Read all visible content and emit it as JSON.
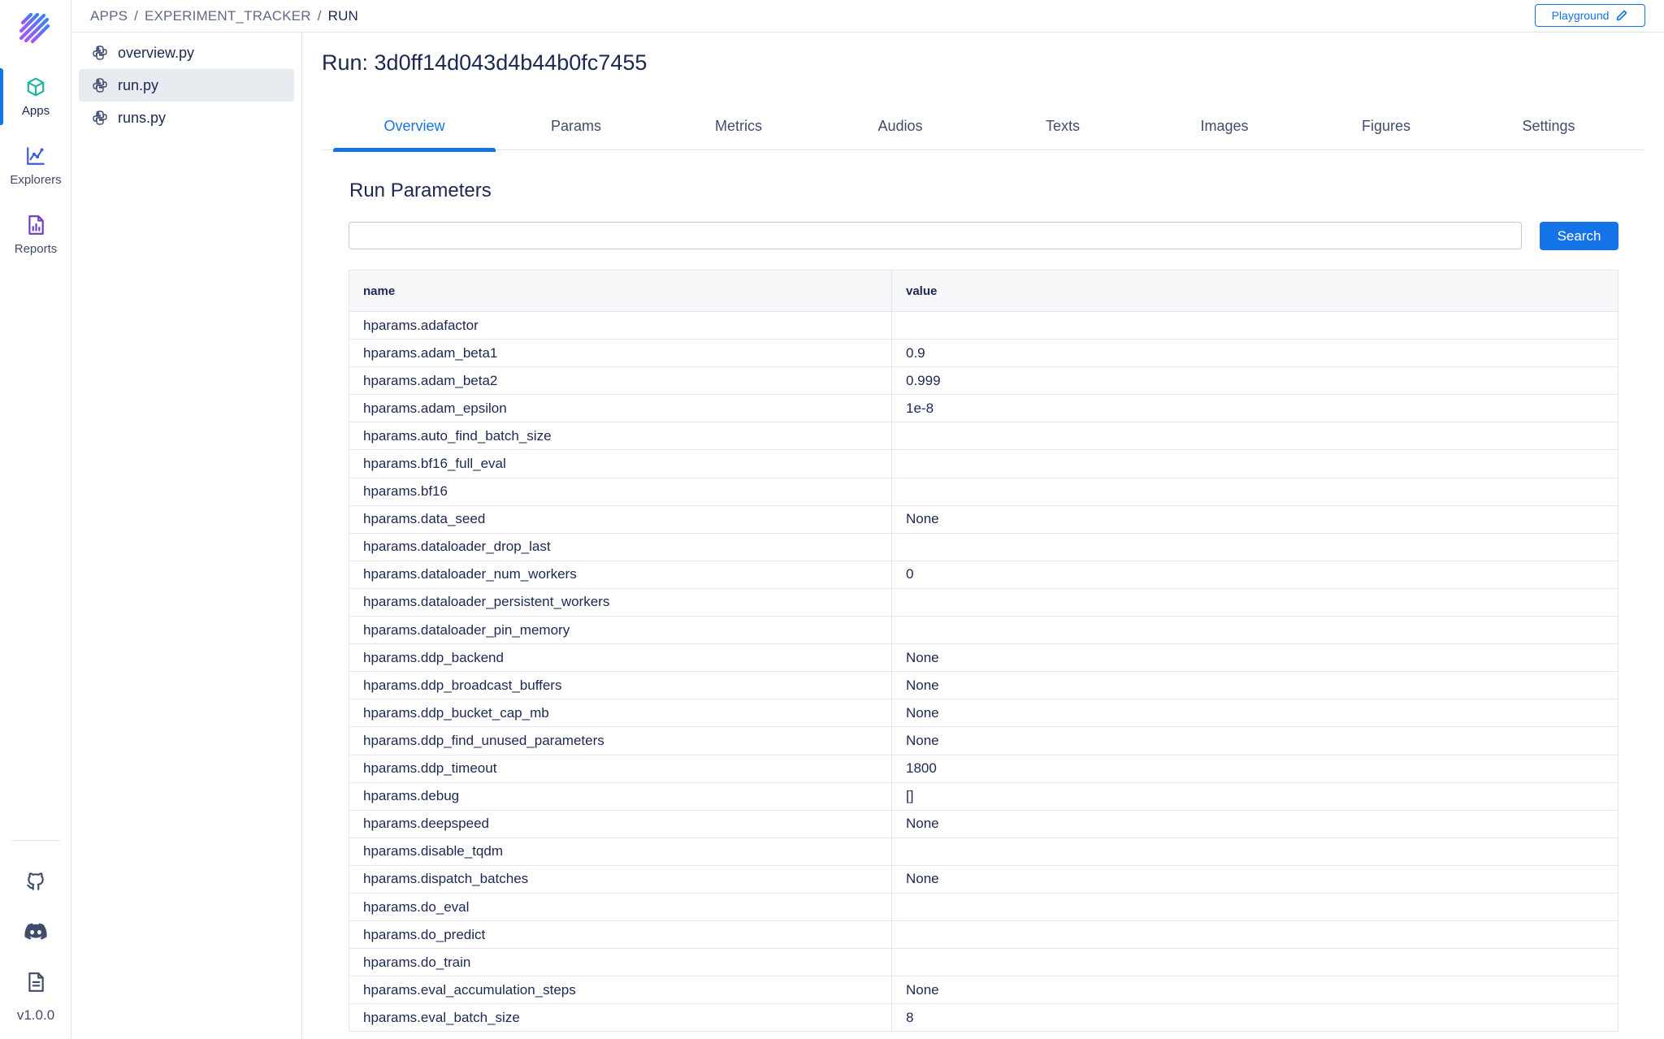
{
  "app": {
    "version": "v1.0.0",
    "accent": "#1473e6"
  },
  "rail": {
    "items": [
      {
        "label": "Apps",
        "icon": "cube-icon",
        "active": true
      },
      {
        "label": "Explorers",
        "icon": "chart-icon",
        "active": false
      },
      {
        "label": "Reports",
        "icon": "report-icon",
        "active": false
      }
    ],
    "bottom_icons": [
      "github-icon",
      "discord-icon",
      "docs-icon"
    ]
  },
  "breadcrumb": {
    "part1": "APPS",
    "part2": "EXPERIMENT_TRACKER",
    "current": "RUN",
    "separator": "/"
  },
  "toolbar": {
    "playground_label": "Playground"
  },
  "files": [
    {
      "name": "overview.py",
      "active": false
    },
    {
      "name": "run.py",
      "active": true
    },
    {
      "name": "runs.py",
      "active": false
    }
  ],
  "main": {
    "title": "Run: 3d0ff14d043d4b44b0fc7455",
    "tabs": [
      "Overview",
      "Params",
      "Metrics",
      "Audios",
      "Texts",
      "Images",
      "Figures",
      "Settings"
    ],
    "active_tab": "Overview",
    "section_title": "Run Parameters",
    "search": {
      "value": "",
      "placeholder": "",
      "button_label": "Search"
    },
    "table": {
      "columns": [
        "name",
        "value"
      ],
      "rows": [
        [
          "hparams.adafactor",
          ""
        ],
        [
          "hparams.adam_beta1",
          "0.9"
        ],
        [
          "hparams.adam_beta2",
          "0.999"
        ],
        [
          "hparams.adam_epsilon",
          "1e-8"
        ],
        [
          "hparams.auto_find_batch_size",
          ""
        ],
        [
          "hparams.bf16_full_eval",
          ""
        ],
        [
          "hparams.bf16",
          ""
        ],
        [
          "hparams.data_seed",
          "None"
        ],
        [
          "hparams.dataloader_drop_last",
          ""
        ],
        [
          "hparams.dataloader_num_workers",
          "0"
        ],
        [
          "hparams.dataloader_persistent_workers",
          ""
        ],
        [
          "hparams.dataloader_pin_memory",
          ""
        ],
        [
          "hparams.ddp_backend",
          "None"
        ],
        [
          "hparams.ddp_broadcast_buffers",
          "None"
        ],
        [
          "hparams.ddp_bucket_cap_mb",
          "None"
        ],
        [
          "hparams.ddp_find_unused_parameters",
          "None"
        ],
        [
          "hparams.ddp_timeout",
          "1800"
        ],
        [
          "hparams.debug",
          "[]"
        ],
        [
          "hparams.deepspeed",
          "None"
        ],
        [
          "hparams.disable_tqdm",
          ""
        ],
        [
          "hparams.dispatch_batches",
          "None"
        ],
        [
          "hparams.do_eval",
          ""
        ],
        [
          "hparams.do_predict",
          ""
        ],
        [
          "hparams.do_train",
          ""
        ],
        [
          "hparams.eval_accumulation_steps",
          "None"
        ],
        [
          "hparams.eval_batch_size",
          "8"
        ]
      ]
    }
  }
}
